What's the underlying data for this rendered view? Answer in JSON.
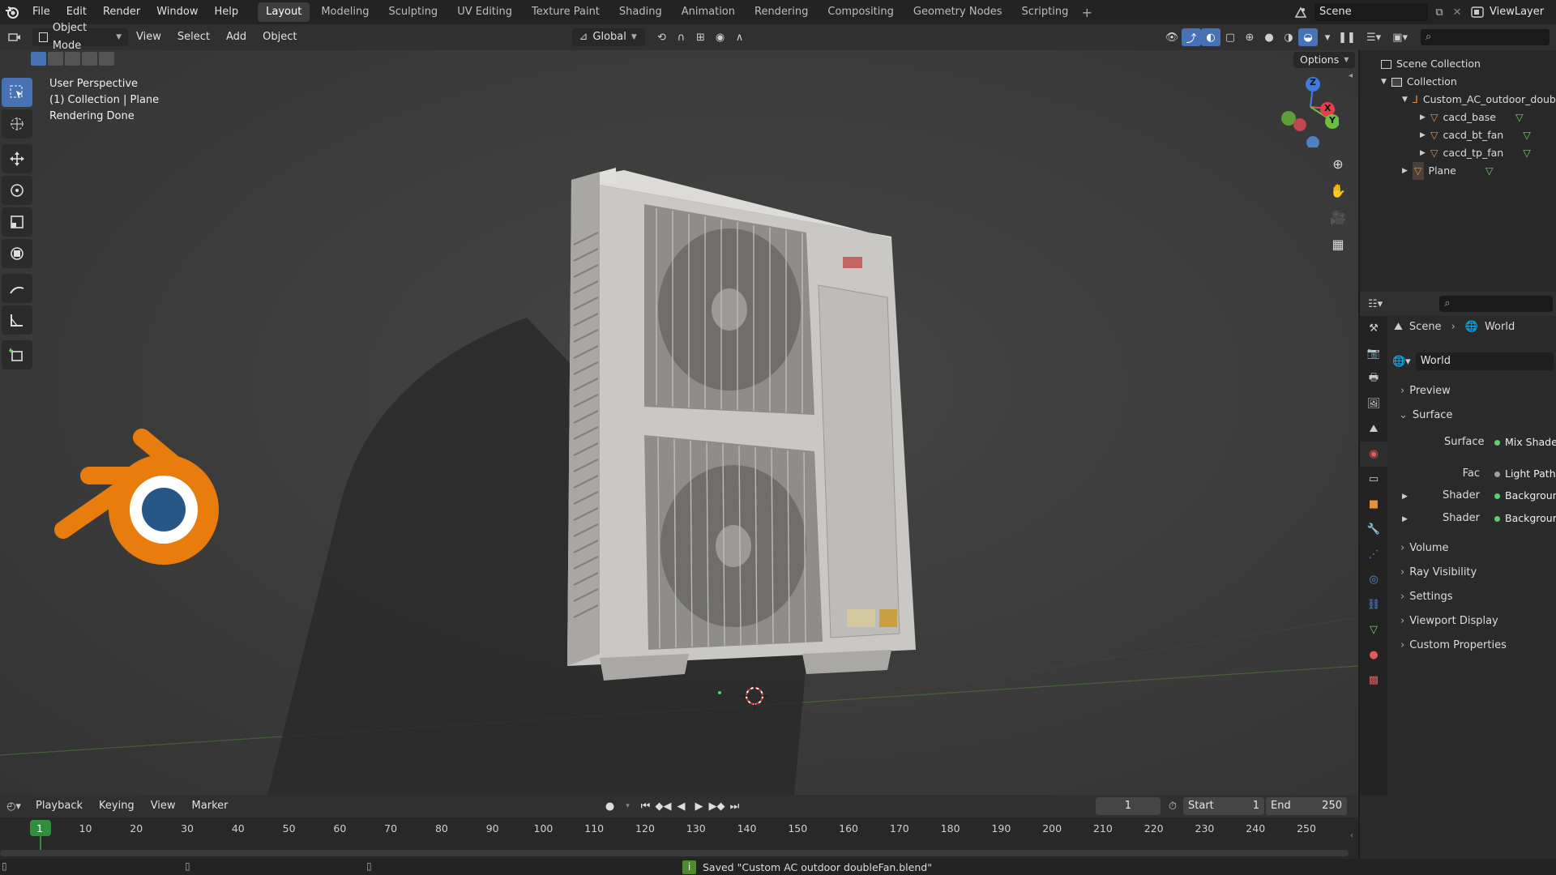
{
  "menu": [
    "File",
    "Edit",
    "Render",
    "Window",
    "Help"
  ],
  "workspaces": [
    "Layout",
    "Modeling",
    "Sculpting",
    "UV Editing",
    "Texture Paint",
    "Shading",
    "Animation",
    "Rendering",
    "Compositing",
    "Geometry Nodes",
    "Scripting"
  ],
  "active_workspace": "Layout",
  "scene_name": "Scene",
  "view_layer": "ViewLayer",
  "vp_header": {
    "mode": "Object Mode",
    "menus": [
      "View",
      "Select",
      "Add",
      "Object"
    ],
    "orientation": "Global",
    "options": "Options"
  },
  "viewport_info": {
    "line1": "User Perspective",
    "line2": "(1) Collection | Plane",
    "line3": "Rendering Done"
  },
  "gizmo": {
    "z": "Z",
    "x": "X",
    "y": "Y"
  },
  "outliner": {
    "scene_collection": "Scene Collection",
    "collection": "Collection",
    "items": [
      "Custom_AC_outdoor_doub",
      "cacd_base",
      "cacd_bt_fan",
      "cacd_tp_fan",
      "Plane"
    ]
  },
  "properties": {
    "breadcrumb_scene": "Scene",
    "breadcrumb_world": "World",
    "world_name": "World",
    "panels": {
      "preview": "Preview",
      "surface": "Surface",
      "volume": "Volume",
      "ray_visibility": "Ray Visibility",
      "settings": "Settings",
      "viewport_display": "Viewport Display",
      "custom_properties": "Custom Properties"
    },
    "surface_label": "Surface",
    "surface_value": "Mix Shader",
    "fac_label": "Fac",
    "fac_value": "Light Path",
    "shader_label": "Shader",
    "shader1_value": "Background",
    "shader2_value": "Background"
  },
  "timeline": {
    "menus": [
      "Playback",
      "Keying",
      "View",
      "Marker"
    ],
    "current_frame": "1",
    "start_label": "Start",
    "start_value": "1",
    "end_label": "End",
    "end_value": "250",
    "ticks": [
      "1",
      "10",
      "20",
      "30",
      "40",
      "50",
      "60",
      "70",
      "80",
      "90",
      "100",
      "110",
      "120",
      "130",
      "140",
      "150",
      "160",
      "170",
      "180",
      "190",
      "200",
      "210",
      "220",
      "230",
      "240",
      "250"
    ]
  },
  "status": "Saved \"Custom AC outdoor doubleFan.blend\"",
  "colors": {
    "accent": "#4772b3",
    "blender_orange": "#e87d0d",
    "blender_blue": "#265787",
    "frame_green": "#2f8f3f"
  }
}
